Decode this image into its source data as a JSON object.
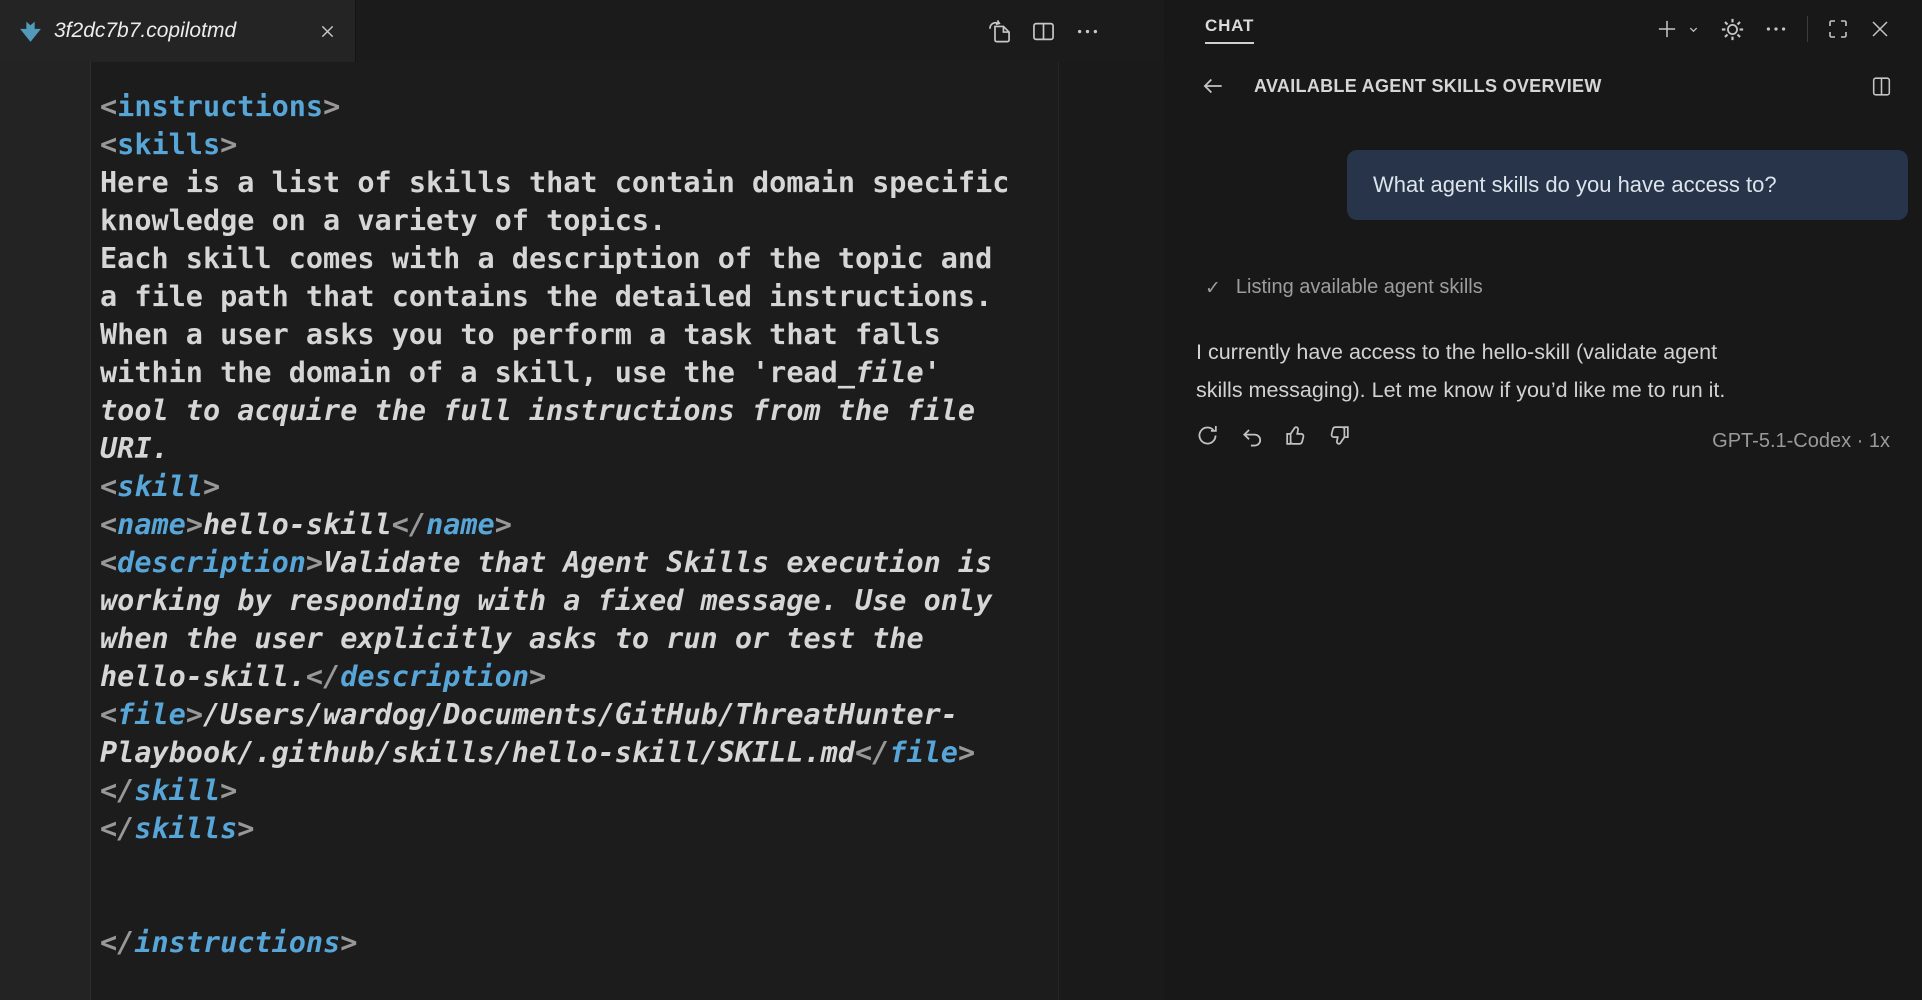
{
  "window": {
    "tab": {
      "filename": "3f2dc7b7.copilotmd"
    },
    "editor_actions": [
      "open-preview",
      "split-editor",
      "more-actions"
    ]
  },
  "editor": {
    "lines": [
      [
        {
          "s": "b",
          "t": "<"
        },
        {
          "s": "t",
          "t": "instructions"
        },
        {
          "s": "b",
          "t": ">"
        }
      ],
      [
        {
          "s": "b",
          "t": "<"
        },
        {
          "s": "t",
          "t": "skills"
        },
        {
          "s": "b",
          "t": ">"
        }
      ],
      [
        {
          "s": "p",
          "t": "Here is a list of skills that contain domain specific"
        }
      ],
      [
        {
          "s": "p",
          "t": "knowledge on a variety of topics."
        }
      ],
      [
        {
          "s": "p",
          "t": "Each skill comes with a description of the topic and"
        }
      ],
      [
        {
          "s": "p",
          "t": "a file path that contains the detailed instructions."
        }
      ],
      [
        {
          "s": "p",
          "t": "When a user asks you to perform a task that falls"
        }
      ],
      [
        {
          "s": "p",
          "t": "within the domain of a skill, use the 'read_"
        },
        {
          "s": "i",
          "t": "file'"
        }
      ],
      [
        {
          "s": "i",
          "t": "tool to acquire the full instructions from the file"
        }
      ],
      [
        {
          "s": "i",
          "t": "URI."
        }
      ],
      [
        {
          "s": "bi",
          "t": "<"
        },
        {
          "s": "ti",
          "t": "skill"
        },
        {
          "s": "bi",
          "t": ">"
        }
      ],
      [
        {
          "s": "bi",
          "t": "<"
        },
        {
          "s": "ti",
          "t": "name"
        },
        {
          "s": "bi",
          "t": ">"
        },
        {
          "s": "i",
          "t": "hello-skill"
        },
        {
          "s": "bi",
          "t": "</"
        },
        {
          "s": "ti",
          "t": "name"
        },
        {
          "s": "bi",
          "t": ">"
        }
      ],
      [
        {
          "s": "bi",
          "t": "<"
        },
        {
          "s": "ti",
          "t": "description"
        },
        {
          "s": "bi",
          "t": ">"
        },
        {
          "s": "i",
          "t": "Validate that Agent Skills execution is"
        }
      ],
      [
        {
          "s": "i",
          "t": "working by responding with a fixed message. Use only"
        }
      ],
      [
        {
          "s": "i",
          "t": "when the user explicitly asks to run or test the"
        }
      ],
      [
        {
          "s": "i",
          "t": "hello-skill."
        },
        {
          "s": "bi",
          "t": "</"
        },
        {
          "s": "ti",
          "t": "description"
        },
        {
          "s": "bi",
          "t": ">"
        }
      ],
      [
        {
          "s": "bi",
          "t": "<"
        },
        {
          "s": "ti",
          "t": "file"
        },
        {
          "s": "bi",
          "t": ">"
        },
        {
          "s": "i",
          "t": "/Users/wardog/Documents/GitHub/ThreatHunter-"
        }
      ],
      [
        {
          "s": "i",
          "t": "Playbook/.github/skills/hello-skill/SKILL.md"
        },
        {
          "s": "bi",
          "t": "</"
        },
        {
          "s": "ti",
          "t": "file"
        },
        {
          "s": "bi",
          "t": ">"
        }
      ],
      [
        {
          "s": "bi",
          "t": "</"
        },
        {
          "s": "ti",
          "t": "skill"
        },
        {
          "s": "bi",
          "t": ">"
        }
      ],
      [
        {
          "s": "bi",
          "t": "</"
        },
        {
          "s": "ti",
          "t": "skills"
        },
        {
          "s": "bi",
          "t": ">"
        }
      ],
      [],
      [],
      [
        {
          "s": "bi",
          "t": "</"
        },
        {
          "s": "ti",
          "t": "instructions"
        },
        {
          "s": "bi",
          "t": ">"
        }
      ]
    ]
  },
  "chat": {
    "tab_label": "CHAT",
    "header": {
      "title": "AVAILABLE AGENT SKILLS OVERVIEW"
    },
    "user_message": "What agent skills do you have access to?",
    "status": {
      "check_glyph": "✓",
      "label": "Listing available agent skills"
    },
    "response_lines": [
      "I currently have access to the hello-skill (validate agent",
      "skills messaging). Let me know if you’d like me to run it."
    ],
    "meta": "GPT-5.1-Codex · 1x"
  },
  "icons": {
    "tab_file_icon": "blue-down-arrow",
    "editor_toolbar": [
      "open-preview",
      "split-editor",
      "more-actions"
    ],
    "chat_toolbar": [
      "new-chat",
      "chevron-down",
      "settings-gear",
      "more-actions",
      "screen-full",
      "close"
    ],
    "chat_header": [
      "arrow-back",
      "split-view"
    ],
    "message_actions": [
      "regenerate",
      "undo",
      "thumbs-up",
      "thumbs-down"
    ]
  },
  "colors": {
    "tag_blue": "#58a6d8",
    "code_fg": "#d6d6d6",
    "bubble_bg": "#273449",
    "file_icon_blue": "#519aba"
  }
}
